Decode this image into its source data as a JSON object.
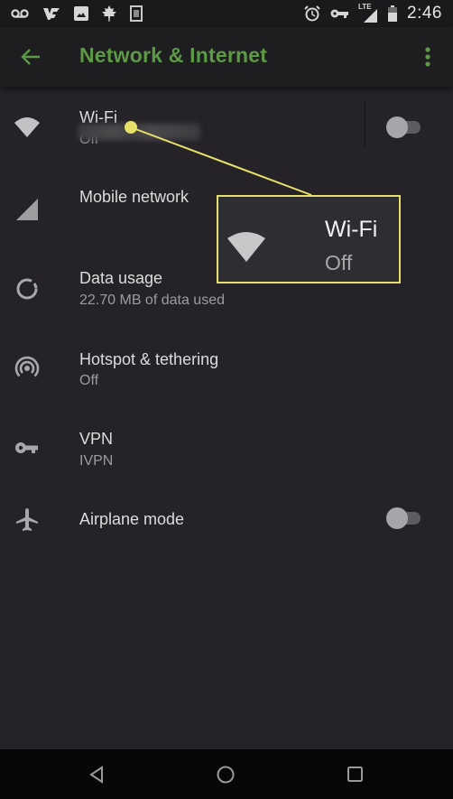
{
  "status_bar": {
    "left_icons": [
      "voicemail-icon",
      "app-notification-icon",
      "image-icon",
      "leaf-icon",
      "sim-card-icon"
    ],
    "right_icons": [
      "alarm-icon",
      "vpn-key-icon",
      "lte-signal-icon",
      "battery-icon"
    ],
    "network_label": "LTE",
    "time": "2:46"
  },
  "toolbar": {
    "back_icon": "arrow-left-icon",
    "title": "Network & Internet",
    "more_icon": "more-vert-icon",
    "title_color": "#5c9a45"
  },
  "settings": [
    {
      "id": "wifi",
      "icon": "wifi-icon",
      "title": "Wi-Fi",
      "subtitle": "Off",
      "toggle": false
    },
    {
      "id": "mobile-network",
      "icon": "cell-signal-icon",
      "title": "Mobile network",
      "subtitle": "(blurred)"
    },
    {
      "id": "data-usage",
      "icon": "data-usage-icon",
      "title": "Data usage",
      "subtitle": "22.70 MB of data used"
    },
    {
      "id": "hotspot",
      "icon": "hotspot-icon",
      "title": "Hotspot & tethering",
      "subtitle": "Off"
    },
    {
      "id": "vpn",
      "icon": "vpn-key-icon",
      "title": "VPN",
      "subtitle": "IVPN"
    },
    {
      "id": "airplane",
      "icon": "airplane-icon",
      "title": "Airplane mode",
      "toggle": false
    }
  ],
  "callout": {
    "title": "Wi-Fi",
    "subtitle": "Off",
    "icon": "wifi-icon",
    "color": "#e6e06a"
  },
  "nav_bar": {
    "buttons": [
      "back-triangle-icon",
      "home-circle-icon",
      "recents-square-icon"
    ]
  }
}
